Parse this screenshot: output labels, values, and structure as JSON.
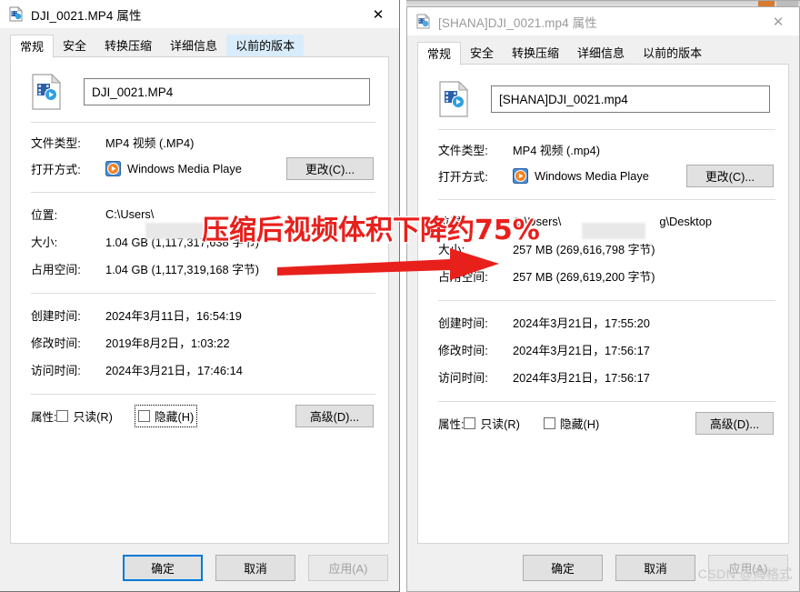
{
  "left_window": {
    "title": "DJI_0021.MP4 属性",
    "title_icon": "video-file-icon",
    "close_label": "✕",
    "tabs": [
      {
        "label": "常规",
        "state": "active"
      },
      {
        "label": "安全",
        "state": "normal"
      },
      {
        "label": "转换压缩",
        "state": "normal"
      },
      {
        "label": "详细信息",
        "state": "normal"
      },
      {
        "label": "以前的版本",
        "state": "hover"
      }
    ],
    "filename": "DJI_0021.MP4",
    "rows": {
      "filetype_label": "文件类型:",
      "filetype_value": "MP4 视频 (.MP4)",
      "openwith_label": "打开方式:",
      "openwith_value": "Windows Media Playe",
      "change_button": "更改(C)...",
      "location_label": "位置:",
      "location_value": "C:\\Users\\",
      "size_label": "大小:",
      "size_value": "1.04 GB (1,117,317,638 字节)",
      "ondisk_label": "占用空间:",
      "ondisk_value": "1.04 GB (1,117,319,168 字节)",
      "created_label": "创建时间:",
      "created_value": "2024年3月11日，16:54:19",
      "modified_label": "修改时间:",
      "modified_value": "2019年8月2日，1:03:22",
      "accessed_label": "访问时间:",
      "accessed_value": "2024年3月21日，17:46:14",
      "attrs_label": "属性:",
      "readonly_label": "只读(R)",
      "hidden_label": "隐藏(H)",
      "advanced_button": "高级(D)..."
    },
    "footer": {
      "ok": "确定",
      "cancel": "取消",
      "apply": "应用(A)"
    }
  },
  "right_window": {
    "title": "[SHANA]DJI_0021.mp4 属性",
    "title_icon": "video-file-icon",
    "close_label": "✕",
    "tabs": [
      {
        "label": "常规",
        "state": "active"
      },
      {
        "label": "安全",
        "state": "normal"
      },
      {
        "label": "转换压缩",
        "state": "normal"
      },
      {
        "label": "详细信息",
        "state": "normal"
      },
      {
        "label": "以前的版本",
        "state": "normal"
      }
    ],
    "filename": "[SHANA]DJI_0021.mp4",
    "rows": {
      "filetype_label": "文件类型:",
      "filetype_value": "MP4 视频 (.mp4)",
      "openwith_label": "打开方式:",
      "openwith_value": "Windows Media Playe",
      "change_button": "更改(C)...",
      "location_label": "位置:",
      "location_value": "C:\\Users\\",
      "location_value_tail": "g\\Desktop",
      "size_label": "大小:",
      "size_value": "257 MB (269,616,798 字节)",
      "ondisk_label": "占用空间:",
      "ondisk_value": "257 MB (269,619,200 字节)",
      "created_label": "创建时间:",
      "created_value": "2024年3月21日，17:55:20",
      "modified_label": "修改时间:",
      "modified_value": "2024年3月21日，17:56:17",
      "accessed_label": "访问时间:",
      "accessed_value": "2024年3月21日，17:56:17",
      "attrs_label": "属性:",
      "readonly_label": "只读(R)",
      "hidden_label": "隐藏(H)",
      "advanced_button": "高级(D)..."
    },
    "footer": {
      "ok": "确定",
      "cancel": "取消",
      "apply": "应用(A)"
    }
  },
  "annotation": {
    "text": "压缩后视频体积下降约75%",
    "color": "#e8201c",
    "outline_color": "#ffffff",
    "arrow_color": "#e8201c"
  },
  "watermark": {
    "text": "CSDN @海格式"
  }
}
